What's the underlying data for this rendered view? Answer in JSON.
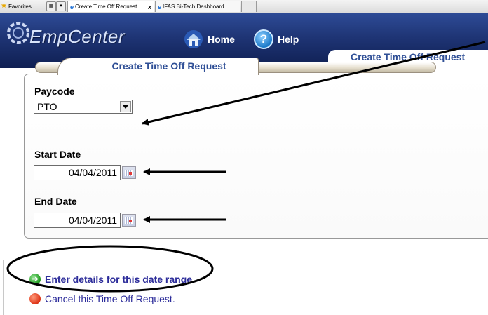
{
  "browser": {
    "favorites_label": "Favorites",
    "tabs": [
      {
        "title": "Create Time Off Request",
        "close": "x"
      },
      {
        "title": "IFAS Bi-Tech Dashboard"
      }
    ]
  },
  "header": {
    "brand": "EmpCenter",
    "nav": [
      {
        "label": "Home",
        "icon": "home-icon"
      },
      {
        "label": "Help",
        "icon": "help-icon",
        "glyph": "?"
      }
    ],
    "page_title": "Create Time Off Request"
  },
  "form": {
    "section_title": "Create Time Off Request",
    "paycode_label": "Paycode",
    "paycode_value": "PTO",
    "start_label": "Start Date",
    "start_value": "04/04/2011",
    "end_label": "End Date",
    "end_value": "04/04/2011"
  },
  "actions": {
    "enter_details": "Enter details for this date range.",
    "cancel": "Cancel this Time Off Request."
  },
  "colors": {
    "header_blue": "#1e3474",
    "title_blue": "#2f4f96",
    "link_blue": "#2c2c9a"
  }
}
